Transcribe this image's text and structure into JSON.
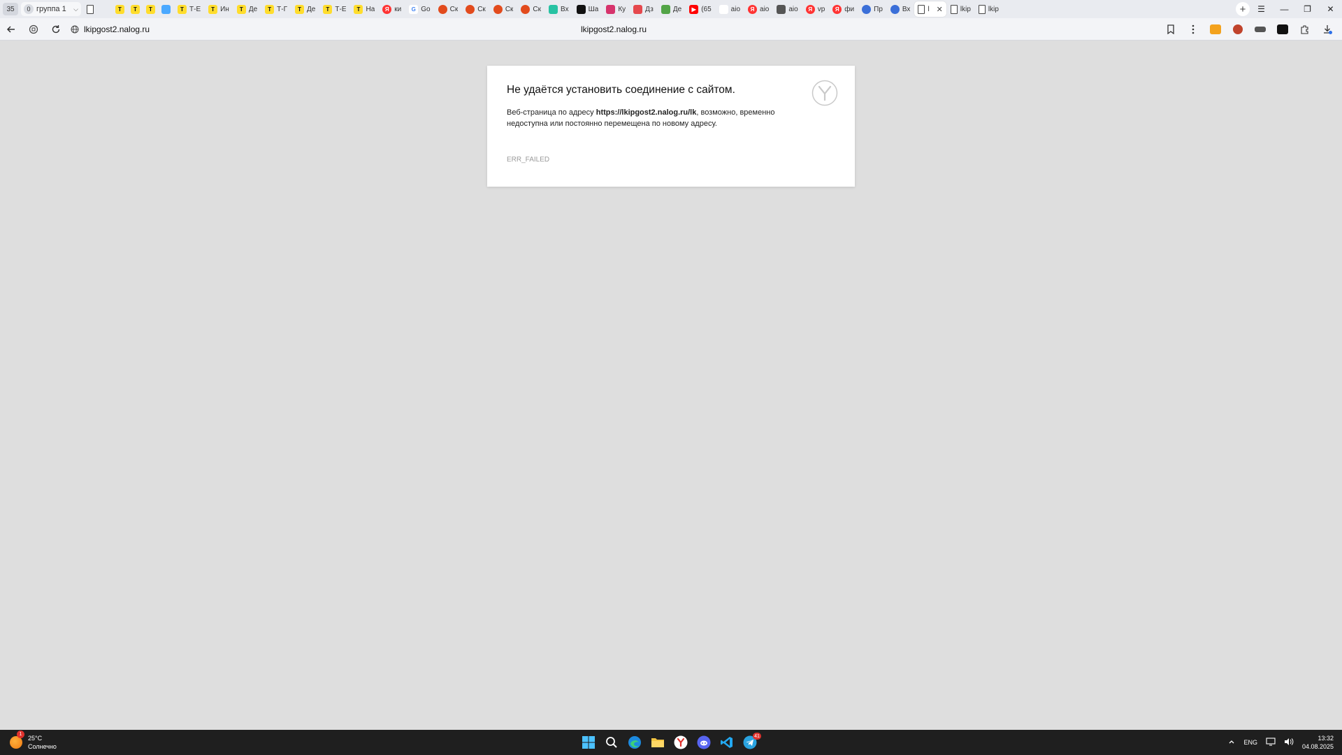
{
  "tabstrip": {
    "group_count": "35",
    "group": {
      "count": "0",
      "name": "группа 1"
    },
    "tabs": [
      {
        "title": "",
        "icon": "page-icon",
        "color": "#ffffff"
      },
      {
        "title": "",
        "icon": "blank-icon",
        "color": "#e9ebf0"
      },
      {
        "title": "",
        "icon": "tbank-icon",
        "color": "#ffdd2d"
      },
      {
        "title": "",
        "icon": "tbank-icon",
        "color": "#ffdd2d"
      },
      {
        "title": "",
        "icon": "tbank-icon",
        "color": "#ffdd2d"
      },
      {
        "title": "",
        "icon": "chart-icon",
        "color": "#4aa8ff"
      },
      {
        "title": "Т-Е",
        "icon": "tbank-icon",
        "color": "#ffdd2d"
      },
      {
        "title": "Ин",
        "icon": "tbank-icon",
        "color": "#ffdd2d"
      },
      {
        "title": "Де",
        "icon": "tbank-icon",
        "color": "#ffdd2d"
      },
      {
        "title": "Т-Г",
        "icon": "tbank-icon",
        "color": "#ffdd2d"
      },
      {
        "title": "Де",
        "icon": "tbank-icon",
        "color": "#ffdd2d"
      },
      {
        "title": "Т-Е",
        "icon": "tbank-icon",
        "color": "#ffdd2d"
      },
      {
        "title": "На",
        "icon": "tbank-icon",
        "color": "#ffdd2d"
      },
      {
        "title": "ки",
        "icon": "yandex-icon",
        "color": "#f33"
      },
      {
        "title": "Go",
        "icon": "google-icon",
        "color": "#ffffff"
      },
      {
        "title": "Ск",
        "icon": "skillbox-icon",
        "color": "#e24b1d"
      },
      {
        "title": "Ск",
        "icon": "skillbox-icon",
        "color": "#e24b1d"
      },
      {
        "title": "Ск",
        "icon": "skillbox-icon",
        "color": "#e24b1d"
      },
      {
        "title": "Ск",
        "icon": "skillbox-icon",
        "color": "#e24b1d"
      },
      {
        "title": "Вх",
        "icon": "mail-icon",
        "color": "#27c2a3"
      },
      {
        "title": "Ша",
        "icon": "openai-icon",
        "color": "#111111"
      },
      {
        "title": "Ку",
        "icon": "code-icon",
        "color": "#d6336c"
      },
      {
        "title": "Дз",
        "icon": "font-icon",
        "color": "#e5484d"
      },
      {
        "title": "Де",
        "icon": "cloud-icon",
        "color": "#52a447"
      },
      {
        "title": "(65",
        "icon": "youtube-icon",
        "color": "#ff0000"
      },
      {
        "title": "aio",
        "icon": "blank-icon",
        "color": "#ffffff"
      },
      {
        "title": "aio",
        "icon": "yandex-icon",
        "color": "#f33"
      },
      {
        "title": "aio",
        "icon": "doc-icon",
        "color": "#555"
      },
      {
        "title": "vp",
        "icon": "yandex-icon",
        "color": "#f33"
      },
      {
        "title": "фи",
        "icon": "yandex-icon",
        "color": "#f33"
      },
      {
        "title": "Пр",
        "icon": "globe-icon",
        "color": "#3b6fd8"
      },
      {
        "title": "Вх",
        "icon": "globe-icon",
        "color": "#3b6fd8"
      },
      {
        "title": "l",
        "icon": "page-icon",
        "color": "#ffffff",
        "active": true
      },
      {
        "title": "lkip",
        "icon": "page-icon",
        "color": "#ffffff"
      },
      {
        "title": "lkip",
        "icon": "page-icon",
        "color": "#ffffff"
      }
    ],
    "close_glyph": "✕",
    "new_tab_glyph": "+",
    "window": {
      "menu": "☰",
      "minimize": "—",
      "restore": "❐",
      "close": "✕"
    }
  },
  "navbar": {
    "url": "lkipgost2.nalog.ru",
    "page_title": "lkipgost2.nalog.ru"
  },
  "error": {
    "title": "Не удаётся установить соединение с сайтом.",
    "desc_before": "Веб-страница по адресу ",
    "desc_url": "https://lkipgost2.nalog.ru/lk",
    "desc_after": ", возможно, временно недоступна или постоянно перемещена по новому адресу.",
    "code": "ERR_FAILED"
  },
  "taskbar": {
    "weather": {
      "badge": "1",
      "temp": "25°C",
      "condition": "Солнечно"
    },
    "apps": [
      {
        "name": "start-button-icon"
      },
      {
        "name": "search-icon"
      },
      {
        "name": "edge-icon"
      },
      {
        "name": "file-explorer-icon"
      },
      {
        "name": "yandex-browser-icon"
      },
      {
        "name": "discord-icon"
      },
      {
        "name": "vscode-icon"
      },
      {
        "name": "telegram-icon",
        "badge": "41"
      }
    ],
    "tray": {
      "language": "ENG",
      "time": "13:32",
      "date": "04.08.2025"
    }
  }
}
